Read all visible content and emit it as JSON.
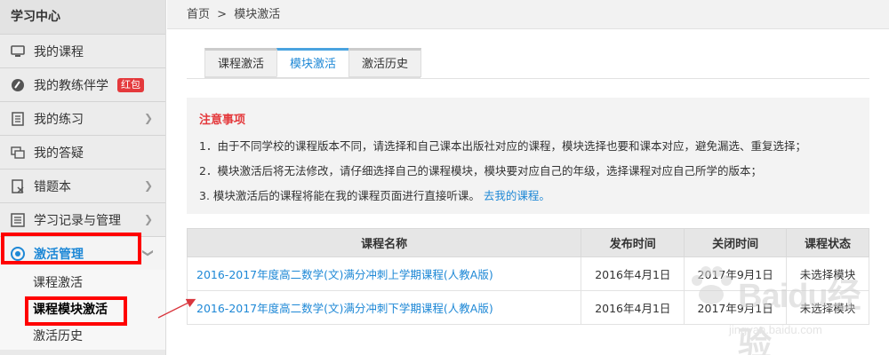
{
  "sidebar": {
    "title": "学习中心",
    "items": [
      {
        "label": "我的课程",
        "icon": "monitor-icon"
      },
      {
        "label": "我的教练伴学",
        "icon": "coach-icon",
        "badge": "红包"
      },
      {
        "label": "我的练习",
        "icon": "list-icon"
      },
      {
        "label": "我的答疑",
        "icon": "chat-icon"
      },
      {
        "label": "错题本",
        "icon": "wrong-book-icon"
      },
      {
        "label": "学习记录与管理",
        "icon": "record-icon"
      },
      {
        "label": "激活管理",
        "icon": "activate-icon"
      }
    ],
    "sub_items": [
      {
        "label": "课程激活"
      },
      {
        "label": "课程模块激活"
      },
      {
        "label": "激活历史"
      }
    ]
  },
  "breadcrumb": {
    "home": "首页",
    "separator": ">",
    "current": "模块激活"
  },
  "tabs": [
    {
      "label": "课程激活"
    },
    {
      "label": "模块激活"
    },
    {
      "label": "激活历史"
    }
  ],
  "notice": {
    "title": "注意事项",
    "lines": [
      "1．由于不同学校的课程版本不同，请选择和自己课本出版社对应的课程，模块选择也要和课本对应，避免漏选、重复选择；",
      "2．模块激活后将无法修改，请仔细选择自己的课程模块，模块要对应自己的年级，选择课程对应自己所学的版本；",
      "3. 模块激活后的课程将能在我的课程页面进行直接听课。"
    ],
    "link": "去我的课程",
    "link_suffix": "。"
  },
  "table": {
    "headers": [
      "课程名称",
      "发布时间",
      "关闭时间",
      "课程状态"
    ],
    "rows": [
      {
        "name": "2016-2017年度高二数学(文)满分冲刺上学期课程(人教A版)",
        "publish": "2016年4月1日",
        "close": "2017年9月1日",
        "status": "未选择模块"
      },
      {
        "name": "2016-2017年度高二数学(文)满分冲刺下学期课程(人教A版)",
        "publish": "2016年4月1日",
        "close": "2017年9月1日",
        "status": "未选择模块"
      }
    ]
  },
  "watermark": {
    "text": "Baidu经验",
    "sub": "jingyan.baidu.com"
  },
  "colors": {
    "accent": "#1e88d6",
    "highlight": "#ff0000",
    "notice_title": "#e4393c"
  }
}
